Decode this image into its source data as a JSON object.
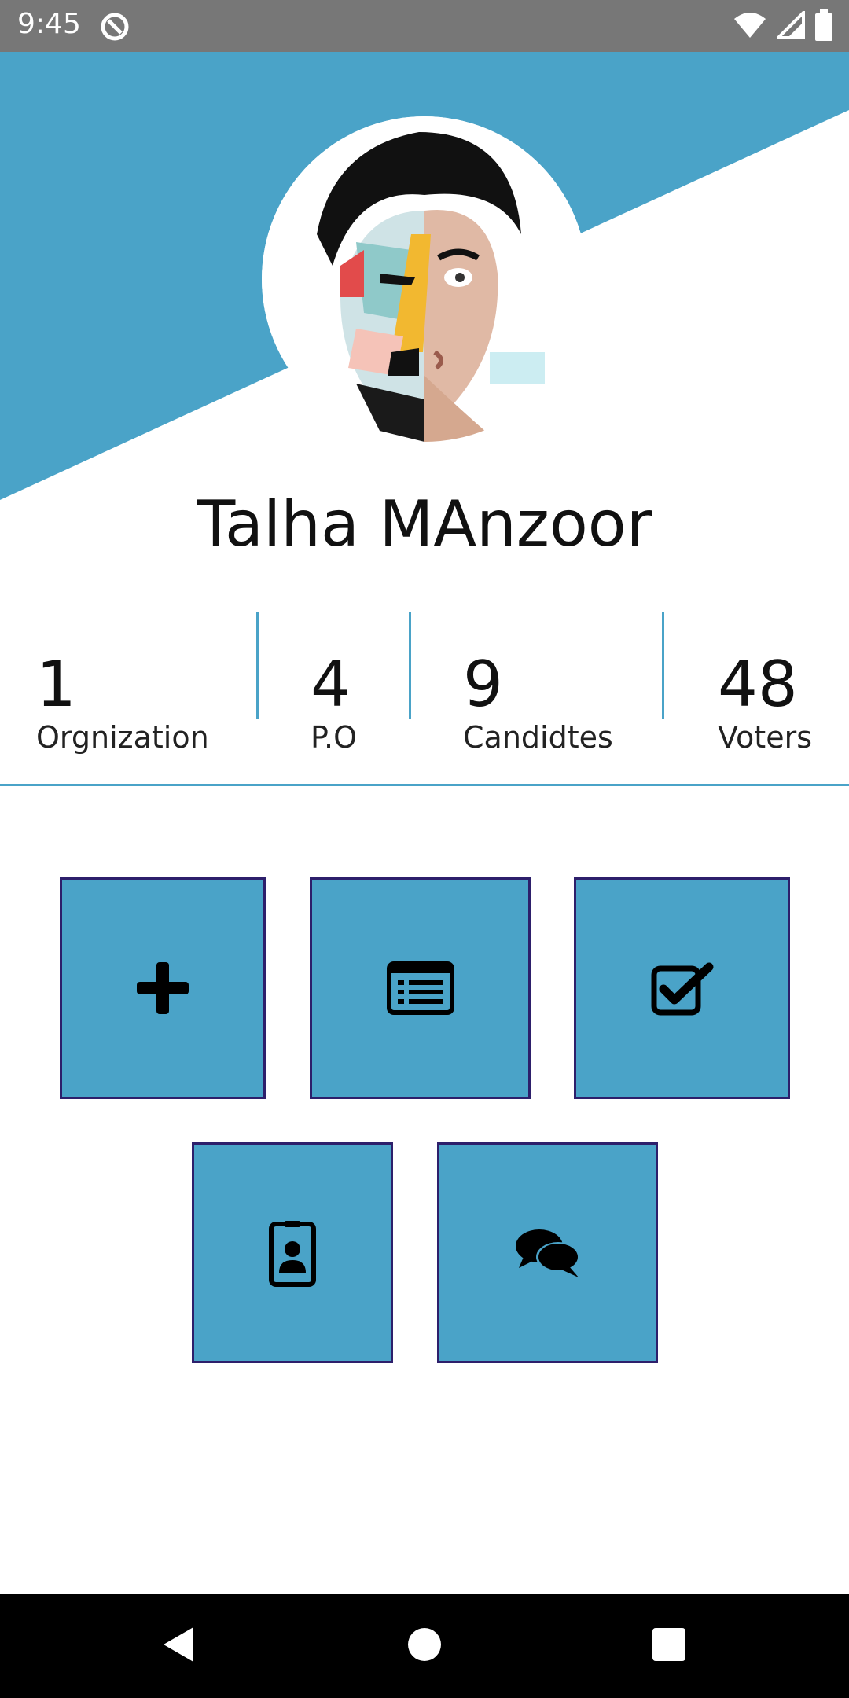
{
  "status_bar": {
    "time": "9:45",
    "icons": [
      "data-saver-icon",
      "wifi-icon",
      "cell-signal-icon",
      "battery-icon"
    ]
  },
  "profile": {
    "name": "Talha MAnzoor",
    "avatar": "avatar-portrait"
  },
  "stats": [
    {
      "value": "1",
      "label": "Orgnization"
    },
    {
      "value": "4",
      "label": "P.O"
    },
    {
      "value": "9",
      "label": "Candidtes"
    },
    {
      "value": "48",
      "label": "Voters"
    }
  ],
  "actions": [
    {
      "icon": "plus-icon"
    },
    {
      "icon": "list-icon"
    },
    {
      "icon": "checkbox-icon"
    },
    {
      "icon": "id-badge-icon"
    },
    {
      "icon": "comments-icon"
    }
  ],
  "nav_bar": {
    "icons": [
      "back-icon",
      "home-icon",
      "recents-icon"
    ]
  },
  "colors": {
    "accent": "#4aa3c8",
    "tile_border": "#2d1f6b",
    "status_bar": "#777777",
    "nav_bar": "#000000"
  }
}
